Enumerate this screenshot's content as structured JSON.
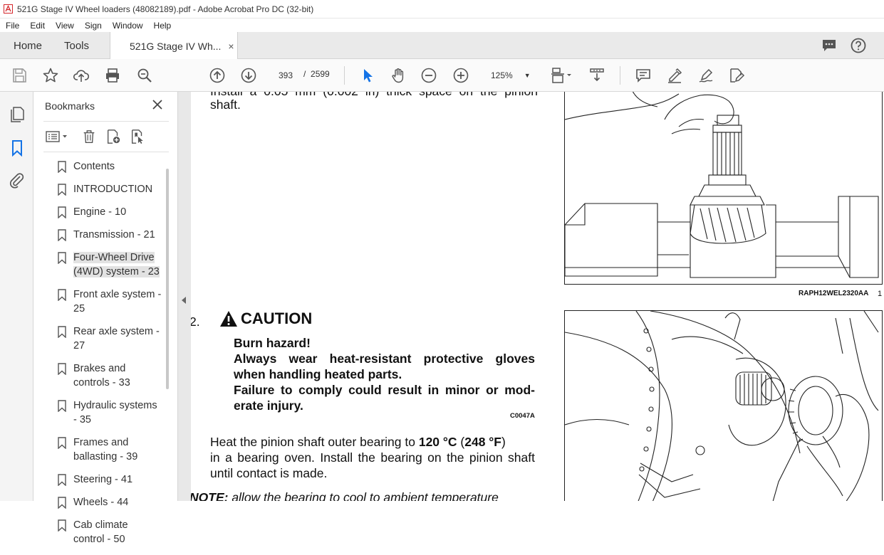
{
  "window": {
    "title": "521G Stage IV Wheel loaders (48082189).pdf - Adobe Acrobat Pro DC (32-bit)"
  },
  "menu": [
    "File",
    "Edit",
    "View",
    "Sign",
    "Window",
    "Help"
  ],
  "tabs": {
    "home": "Home",
    "tools": "Tools",
    "doc": "521G Stage IV Wh...",
    "close": "×"
  },
  "toolbar": {
    "page_current": "393",
    "page_sep": "/",
    "page_total": "2599",
    "zoom": "125%"
  },
  "bookmarks": {
    "title": "Bookmarks",
    "items": [
      {
        "label": "Contents"
      },
      {
        "label": "INTRODUCTION"
      },
      {
        "label": "Engine - 10"
      },
      {
        "label": "Transmission - 21"
      },
      {
        "label": "Four-Wheel Drive (4WD) system - 23",
        "selected": true
      },
      {
        "label": "Front axle system - 25"
      },
      {
        "label": "Rear axle system - 27"
      },
      {
        "label": "Brakes and controls - 33"
      },
      {
        "label": "Hydraulic systems - 35"
      },
      {
        "label": "Frames and ballasting - 39"
      },
      {
        "label": "Steering - 41"
      },
      {
        "label": "Wheels - 44"
      },
      {
        "label": "Cab climate control - 50"
      }
    ]
  },
  "document": {
    "step1_line1": "Install a 0.05 mm (0.002 in) thick space on the pinion",
    "step1_line2": "shaft.",
    "fig1_code": "RAPH12WEL2320AA",
    "fig1_num": "1",
    "step2_num": "2.",
    "caution_title": "CAUTION",
    "caution_lines": [
      "Burn hazard!",
      "Always wear heat-resistant protective gloves",
      "when handling heated parts.",
      "Failure to comply could result in minor or mod-",
      "erate injury."
    ],
    "caution_code": "C0047A",
    "heat_line1_pre": "Heat the pinion shaft outer bearing to ",
    "heat_temp_c": "120 °C",
    "heat_mid": " (",
    "heat_temp_f": "248 °F",
    "heat_end": ")",
    "heat_line2": "in a bearing oven.  Install the bearing on the pinion shaft",
    "heat_line3": "until contact is made.",
    "note_label": "NOTE:",
    "note_text": " allow the bearing to cool to ambient temperature"
  }
}
